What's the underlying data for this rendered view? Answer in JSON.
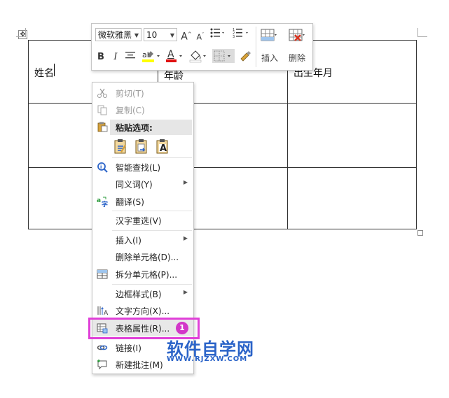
{
  "table": {
    "headers": [
      "姓名",
      "年龄",
      "出生年月"
    ]
  },
  "mini_toolbar": {
    "font_name": "微软雅黑",
    "font_size": "10",
    "insert_label": "插入",
    "delete_label": "删除",
    "bold_label": "B",
    "italic_label": "I",
    "font_color_label": "A",
    "grow_font_label": "A",
    "shrink_font_label": "A",
    "highlight_color": "#ffff00",
    "font_color": "#e01010"
  },
  "context_menu": {
    "items": [
      {
        "label": "剪切(T)",
        "icon": "scissors-icon",
        "enabled": false
      },
      {
        "label": "复制(C)",
        "icon": "copy-icon",
        "enabled": false
      },
      {
        "label": "粘贴选项:",
        "icon": "paste-icon",
        "enabled": true
      },
      {
        "label": "智能查找(L)",
        "icon": "smart-lookup-icon",
        "enabled": true
      },
      {
        "label": "同义词(Y)",
        "icon": "",
        "enabled": true,
        "submenu": true
      },
      {
        "label": "翻译(S)",
        "icon": "translate-icon",
        "enabled": true
      },
      {
        "label": "汉字重选(V)",
        "icon": "",
        "enabled": true
      },
      {
        "label": "插入(I)",
        "icon": "",
        "enabled": true,
        "submenu": true
      },
      {
        "label": "删除单元格(D)...",
        "icon": "",
        "enabled": true
      },
      {
        "label": "拆分单元格(P)...",
        "icon": "split-cells-icon",
        "enabled": true
      },
      {
        "label": "边框样式(B)",
        "icon": "",
        "enabled": true,
        "submenu": true
      },
      {
        "label": "文字方向(X)...",
        "icon": "text-direction-icon",
        "enabled": true
      },
      {
        "label": "表格属性(R)...",
        "icon": "table-properties-icon",
        "enabled": true
      },
      {
        "label": "链接(I)",
        "icon": "link-icon",
        "enabled": true
      },
      {
        "label": "新建批注(M)",
        "icon": "new-comment-icon",
        "enabled": true
      }
    ],
    "paste_icon_letter": "A"
  },
  "annotation": {
    "step_number": "1",
    "highlight_color": "#e040d8"
  },
  "watermark": {
    "title": "软件自学网",
    "url": "WWW.RJZXW.COM",
    "color": "#2a63c8"
  }
}
